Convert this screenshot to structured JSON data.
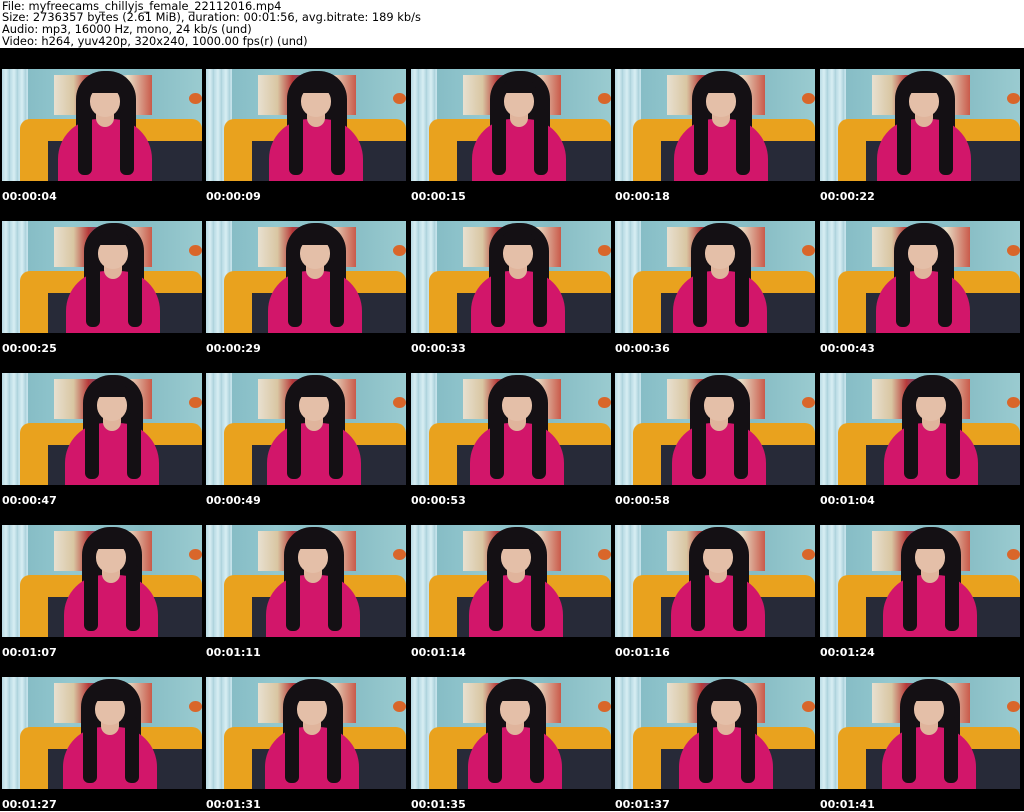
{
  "header": {
    "file": "File: myfreecams_chillyjs_female_22112016.mp4",
    "size": "Size: 2736357 bytes (2.61 MiB), duration: 00:01:56, avg.bitrate: 189 kb/s",
    "audio": "Audio: mp3, 16000 Hz, mono, 24 kb/s (und)",
    "video": "Video: h264, yuv420p, 320x240, 1000.00 fps(r) (und)"
  },
  "thumbnails": [
    {
      "timestamp": "00:00:04"
    },
    {
      "timestamp": "00:00:09"
    },
    {
      "timestamp": "00:00:15"
    },
    {
      "timestamp": "00:00:18"
    },
    {
      "timestamp": "00:00:22"
    },
    {
      "timestamp": "00:00:25"
    },
    {
      "timestamp": "00:00:29"
    },
    {
      "timestamp": "00:00:33"
    },
    {
      "timestamp": "00:00:36"
    },
    {
      "timestamp": "00:00:43"
    },
    {
      "timestamp": "00:00:47"
    },
    {
      "timestamp": "00:00:49"
    },
    {
      "timestamp": "00:00:53"
    },
    {
      "timestamp": "00:00:58"
    },
    {
      "timestamp": "00:01:04"
    },
    {
      "timestamp": "00:01:07"
    },
    {
      "timestamp": "00:01:11"
    },
    {
      "timestamp": "00:01:14"
    },
    {
      "timestamp": "00:01:16"
    },
    {
      "timestamp": "00:01:24"
    },
    {
      "timestamp": "00:01:27"
    },
    {
      "timestamp": "00:01:31"
    },
    {
      "timestamp": "00:01:35"
    },
    {
      "timestamp": "00:01:37"
    },
    {
      "timestamp": "00:01:41"
    }
  ],
  "colors": {
    "sheet_background": "#000000",
    "header_background": "#ffffff",
    "timestamp_text": "#ffffff",
    "header_text": "#000000"
  }
}
